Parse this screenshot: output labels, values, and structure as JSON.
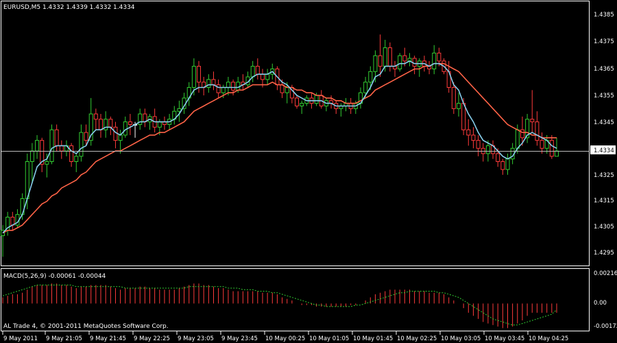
{
  "window": {
    "symbol_info": "EURUSD,M5  1.4332 1.4339 1.4332 1.4334",
    "macd_info": "MACD(5,26,9) -0.00061 -0.00044",
    "copyright": "AL Trade 4, © 2001-2011 MetaQuotes Software Corp.",
    "current_price_label": "1.4334"
  },
  "colors": {
    "background": "#000000",
    "grid_frame": "#ffffff",
    "bull_candle": "#32cd32",
    "bear_candle": "#ff3b3b",
    "doji_candle": "#ffffff",
    "fast_ma": "#87ceeb",
    "slow_ma": "#ff6347",
    "macd_hist": "#ff3b3b",
    "macd_signal": "#32cd32"
  },
  "price_axis": {
    "ticks": [
      "1.4385",
      "1.4375",
      "1.4365",
      "1.4355",
      "1.4345",
      "1.4334",
      "1.4325",
      "1.4315",
      "1.4305",
      "1.4295"
    ]
  },
  "macd_axis": {
    "ticks": [
      "0.00216",
      "0.00",
      "-0.00172"
    ]
  },
  "time_axis": {
    "labels": [
      "9 May 2011",
      "9 May 21:05",
      "9 May 21:45",
      "9 May 22:25",
      "9 May 23:05",
      "9 May 23:45",
      "10 May 00:25",
      "10 May 01:05",
      "10 May 01:45",
      "10 May 02:25",
      "10 May 03:05",
      "10 May 03:45",
      "10 May 04:25"
    ]
  },
  "chart_data": {
    "type": "candlestick",
    "symbol": "EURUSD",
    "timeframe": "M5",
    "price_range": [
      1.4291,
      1.439
    ],
    "current_price": 1.4334,
    "candles": [
      [
        1.4302,
        1.4306,
        1.4294,
        1.4304
      ],
      [
        1.4304,
        1.4311,
        1.4302,
        1.4309
      ],
      [
        1.4309,
        1.4311,
        1.4304,
        1.4306
      ],
      [
        1.4306,
        1.4312,
        1.4305,
        1.431
      ],
      [
        1.431,
        1.4318,
        1.4308,
        1.4316
      ],
      [
        1.4316,
        1.4333,
        1.4312,
        1.433
      ],
      [
        1.433,
        1.4337,
        1.4322,
        1.4334
      ],
      [
        1.4334,
        1.434,
        1.4331,
        1.4338
      ],
      [
        1.4338,
        1.4339,
        1.4326,
        1.4329
      ],
      [
        1.4329,
        1.4333,
        1.4324,
        1.433
      ],
      [
        1.433,
        1.4344,
        1.4329,
        1.4342
      ],
      [
        1.4342,
        1.4344,
        1.4334,
        1.4336
      ],
      [
        1.4336,
        1.4338,
        1.4331,
        1.4334
      ],
      [
        1.4334,
        1.4338,
        1.4332,
        1.4336
      ],
      [
        1.4336,
        1.4337,
        1.4328,
        1.433
      ],
      [
        1.433,
        1.4333,
        1.4326,
        1.4332
      ],
      [
        1.4332,
        1.4344,
        1.433,
        1.4341
      ],
      [
        1.4341,
        1.4344,
        1.4336,
        1.4338
      ],
      [
        1.4338,
        1.4354,
        1.4336,
        1.4348
      ],
      [
        1.4348,
        1.435,
        1.4342,
        1.4346
      ],
      [
        1.4346,
        1.4348,
        1.4339,
        1.4342
      ],
      [
        1.4342,
        1.4349,
        1.4339,
        1.4346
      ],
      [
        1.4346,
        1.4347,
        1.434,
        1.4343
      ],
      [
        1.4343,
        1.4345,
        1.4335,
        1.4338
      ],
      [
        1.4338,
        1.4342,
        1.4333,
        1.434
      ],
      [
        1.434,
        1.4347,
        1.4339,
        1.4345
      ],
      [
        1.4345,
        1.4348,
        1.434,
        1.4344
      ],
      [
        1.4344,
        1.4345,
        1.4339,
        1.4344
      ],
      [
        1.4344,
        1.435,
        1.4342,
        1.4348
      ],
      [
        1.4348,
        1.435,
        1.4343,
        1.4345
      ],
      [
        1.4345,
        1.4348,
        1.4342,
        1.4347
      ],
      [
        1.4347,
        1.435,
        1.4341,
        1.4343
      ],
      [
        1.4343,
        1.4346,
        1.434,
        1.4345
      ],
      [
        1.4345,
        1.4347,
        1.4342,
        1.4344
      ],
      [
        1.4344,
        1.4348,
        1.4342,
        1.4346
      ],
      [
        1.4346,
        1.4351,
        1.4344,
        1.4349
      ],
      [
        1.4349,
        1.4353,
        1.4345,
        1.435
      ],
      [
        1.435,
        1.4356,
        1.4348,
        1.4354
      ],
      [
        1.4354,
        1.436,
        1.4351,
        1.4358
      ],
      [
        1.4358,
        1.4369,
        1.4355,
        1.4366
      ],
      [
        1.4366,
        1.4368,
        1.4356,
        1.436
      ],
      [
        1.436,
        1.4362,
        1.4355,
        1.4358
      ],
      [
        1.4358,
        1.4363,
        1.4356,
        1.4361
      ],
      [
        1.4361,
        1.4364,
        1.4357,
        1.4359
      ],
      [
        1.4359,
        1.4361,
        1.4354,
        1.4356
      ],
      [
        1.4356,
        1.4359,
        1.4354,
        1.4358
      ],
      [
        1.4358,
        1.4362,
        1.4355,
        1.436
      ],
      [
        1.436,
        1.4361,
        1.4355,
        1.4357
      ],
      [
        1.4357,
        1.4362,
        1.4356,
        1.436
      ],
      [
        1.436,
        1.4363,
        1.4357,
        1.4359
      ],
      [
        1.4359,
        1.4364,
        1.4358,
        1.4362
      ],
      [
        1.4362,
        1.4368,
        1.436,
        1.4366
      ],
      [
        1.4366,
        1.4369,
        1.4361,
        1.4363
      ],
      [
        1.4363,
        1.4365,
        1.4358,
        1.4361
      ],
      [
        1.4361,
        1.4365,
        1.4359,
        1.4363
      ],
      [
        1.4363,
        1.4367,
        1.4361,
        1.4365
      ],
      [
        1.4365,
        1.4366,
        1.4357,
        1.4359
      ],
      [
        1.4359,
        1.4361,
        1.4354,
        1.4356
      ],
      [
        1.4356,
        1.436,
        1.4352,
        1.4358
      ],
      [
        1.4358,
        1.4359,
        1.4352,
        1.4354
      ],
      [
        1.4354,
        1.4355,
        1.435,
        1.4351
      ],
      [
        1.4351,
        1.4353,
        1.4348,
        1.4352
      ],
      [
        1.4352,
        1.4355,
        1.4351,
        1.4354
      ],
      [
        1.4354,
        1.4356,
        1.435,
        1.4352
      ],
      [
        1.4352,
        1.4356,
        1.4351,
        1.4355
      ],
      [
        1.4355,
        1.4357,
        1.435,
        1.4351
      ],
      [
        1.4351,
        1.4354,
        1.4349,
        1.4353
      ],
      [
        1.4353,
        1.4355,
        1.435,
        1.4352
      ],
      [
        1.4352,
        1.4353,
        1.4348,
        1.435
      ],
      [
        1.435,
        1.4352,
        1.4347,
        1.4351
      ],
      [
        1.4351,
        1.4354,
        1.4349,
        1.4352
      ],
      [
        1.4352,
        1.4354,
        1.4348,
        1.435
      ],
      [
        1.435,
        1.4353,
        1.4348,
        1.4352
      ],
      [
        1.4352,
        1.4358,
        1.435,
        1.4356
      ],
      [
        1.4356,
        1.4362,
        1.4354,
        1.436
      ],
      [
        1.436,
        1.4366,
        1.4357,
        1.4364
      ],
      [
        1.4364,
        1.4372,
        1.436,
        1.437
      ],
      [
        1.437,
        1.4378,
        1.4362,
        1.4366
      ],
      [
        1.4366,
        1.4376,
        1.4364,
        1.4373
      ],
      [
        1.4373,
        1.4375,
        1.4364,
        1.4366
      ],
      [
        1.4366,
        1.4368,
        1.4362,
        1.4365
      ],
      [
        1.4365,
        1.4371,
        1.4364,
        1.437
      ],
      [
        1.437,
        1.4373,
        1.4366,
        1.4368
      ],
      [
        1.4368,
        1.4371,
        1.4366,
        1.4369
      ],
      [
        1.4369,
        1.437,
        1.4363,
        1.4366
      ],
      [
        1.4366,
        1.4369,
        1.4362,
        1.4368
      ],
      [
        1.4368,
        1.437,
        1.4364,
        1.4366
      ],
      [
        1.4366,
        1.4368,
        1.4363,
        1.4365
      ],
      [
        1.4365,
        1.4374,
        1.4363,
        1.4371
      ],
      [
        1.4371,
        1.4373,
        1.4366,
        1.4368
      ],
      [
        1.4368,
        1.4369,
        1.4363,
        1.4364
      ],
      [
        1.4364,
        1.4368,
        1.4356,
        1.4358
      ],
      [
        1.4358,
        1.436,
        1.4348,
        1.435
      ],
      [
        1.435,
        1.4356,
        1.4347,
        1.4352
      ],
      [
        1.4352,
        1.4354,
        1.434,
        1.4342
      ],
      [
        1.4342,
        1.4346,
        1.4336,
        1.434
      ],
      [
        1.434,
        1.4343,
        1.4335,
        1.4338
      ],
      [
        1.4338,
        1.434,
        1.4332,
        1.4335
      ],
      [
        1.4335,
        1.4337,
        1.433,
        1.4333
      ],
      [
        1.4333,
        1.4338,
        1.433,
        1.4336
      ],
      [
        1.4336,
        1.4338,
        1.4331,
        1.4333
      ],
      [
        1.4333,
        1.4335,
        1.4328,
        1.433
      ],
      [
        1.433,
        1.4331,
        1.4325,
        1.4327
      ],
      [
        1.4327,
        1.4333,
        1.4325,
        1.4331
      ],
      [
        1.4331,
        1.4337,
        1.4329,
        1.4335
      ],
      [
        1.4335,
        1.4344,
        1.4333,
        1.4342
      ],
      [
        1.4342,
        1.4347,
        1.4336,
        1.4339
      ],
      [
        1.4339,
        1.4348,
        1.4337,
        1.4346
      ],
      [
        1.4346,
        1.4357,
        1.4341,
        1.4345
      ],
      [
        1.4345,
        1.4349,
        1.4336,
        1.4338
      ],
      [
        1.4338,
        1.4341,
        1.4333,
        1.4335
      ],
      [
        1.4335,
        1.434,
        1.4333,
        1.4338
      ],
      [
        1.4338,
        1.434,
        1.4331,
        1.4332
      ],
      [
        1.4332,
        1.4339,
        1.4332,
        1.4334
      ]
    ],
    "fast_ma": [
      1.4303,
      1.4305,
      1.4306,
      1.4307,
      1.431,
      1.4316,
      1.4322,
      1.4328,
      1.433,
      1.4331,
      1.4335,
      1.4336,
      1.4336,
      1.4336,
      1.4334,
      1.4333,
      1.4335,
      1.4336,
      1.434,
      1.4342,
      1.4342,
      1.4343,
      1.4343,
      1.4341,
      1.434,
      1.4342,
      1.4343,
      1.4344,
      1.4345,
      1.4345,
      1.4346,
      1.4345,
      1.4345,
      1.4345,
      1.4345,
      1.4346,
      1.4348,
      1.4351,
      1.4354,
      1.4357,
      1.4358,
      1.4358,
      1.4359,
      1.4359,
      1.4358,
      1.4358,
      1.4358,
      1.4358,
      1.4358,
      1.4359,
      1.436,
      1.4362,
      1.4363,
      1.4363,
      1.4363,
      1.4364,
      1.4362,
      1.436,
      1.4359,
      1.4357,
      1.4355,
      1.4354,
      1.4353,
      1.4353,
      1.4353,
      1.4353,
      1.4352,
      1.4352,
      1.4351,
      1.4351,
      1.4351,
      1.4351,
      1.4351,
      1.4352,
      1.4355,
      1.4358,
      1.4362,
      1.4363,
      1.4366,
      1.4366,
      1.4366,
      1.4367,
      1.4367,
      1.4368,
      1.4367,
      1.4367,
      1.4367,
      1.4366,
      1.4367,
      1.4367,
      1.4366,
      1.4364,
      1.4359,
      1.4357,
      1.4352,
      1.4348,
      1.4345,
      1.4341,
      1.4338,
      1.4337,
      1.4336,
      1.4334,
      1.4332,
      1.4331,
      1.4332,
      1.4335,
      1.4337,
      1.434,
      1.4341,
      1.434,
      1.4339,
      1.4338,
      1.4336,
      1.4335
    ],
    "slow_ma": [
      1.4303,
      1.4304,
      1.4304,
      1.4305,
      1.4306,
      1.4308,
      1.431,
      1.4312,
      1.4314,
      1.4315,
      1.4317,
      1.4318,
      1.432,
      1.4321,
      1.4322,
      1.4323,
      1.4325,
      1.4326,
      1.4328,
      1.433,
      1.4331,
      1.4332,
      1.4333,
      1.4334,
      1.4334,
      1.4335,
      1.4336,
      1.4337,
      1.4338,
      1.4339,
      1.434,
      1.434,
      1.4341,
      1.4341,
      1.4342,
      1.4343,
      1.4344,
      1.4345,
      1.4347,
      1.4349,
      1.435,
      1.4351,
      1.4352,
      1.4353,
      1.4354,
      1.4355,
      1.4356,
      1.4356,
      1.4357,
      1.4357,
      1.4358,
      1.4359,
      1.4359,
      1.4359,
      1.4359,
      1.436,
      1.4359,
      1.4359,
      1.4358,
      1.4358,
      1.4357,
      1.4357,
      1.4356,
      1.4356,
      1.4355,
      1.4355,
      1.4354,
      1.4354,
      1.4353,
      1.4353,
      1.4352,
      1.4352,
      1.4352,
      1.4353,
      1.4354,
      1.4355,
      1.4357,
      1.4358,
      1.4359,
      1.436,
      1.4361,
      1.4362,
      1.4363,
      1.4364,
      1.4365,
      1.4365,
      1.4366,
      1.4366,
      1.4367,
      1.4367,
      1.4367,
      1.4366,
      1.4365,
      1.4364,
      1.4362,
      1.436,
      1.4358,
      1.4356,
      1.4354,
      1.4352,
      1.435,
      1.4348,
      1.4346,
      1.4344,
      1.4343,
      1.4342,
      1.4341,
      1.4341,
      1.434,
      1.434,
      1.4339,
      1.4339,
      1.4339,
      1.4339
    ],
    "macd": {
      "range": [
        -0.00172,
        0.00216
      ],
      "hist": [
        0.0004,
        0.0005,
        0.0006,
        0.0006,
        0.0007,
        0.0009,
        0.0011,
        0.0012,
        0.0012,
        0.0012,
        0.0013,
        0.0013,
        0.0012,
        0.0012,
        0.0011,
        0.001,
        0.0011,
        0.0011,
        0.0012,
        0.0012,
        0.0012,
        0.0012,
        0.0011,
        0.001,
        0.0009,
        0.001,
        0.001,
        0.001,
        0.0011,
        0.0011,
        0.001,
        0.001,
        0.0009,
        0.0009,
        0.0009,
        0.0009,
        0.001,
        0.0011,
        0.0012,
        0.0013,
        0.0013,
        0.0012,
        0.0012,
        0.0011,
        0.001,
        0.001,
        0.0009,
        0.0008,
        0.0008,
        0.0008,
        0.0008,
        0.0008,
        0.0008,
        0.0007,
        0.0007,
        0.0007,
        0.0006,
        0.0004,
        0.0003,
        0.0002,
        0.0,
        -0.0001,
        -0.0001,
        -0.0001,
        -0.0002,
        -0.0002,
        -0.0002,
        -0.0002,
        -0.0002,
        -0.0002,
        -0.0002,
        -0.0001,
        -0.0001,
        0.0,
        0.0002,
        0.0004,
        0.0006,
        0.0007,
        0.0008,
        0.0009,
        0.0009,
        0.0009,
        0.0009,
        0.0009,
        0.0008,
        0.0008,
        0.0008,
        0.0007,
        0.0007,
        0.0007,
        0.0006,
        0.0004,
        0.0002,
        0.0,
        -0.0003,
        -0.0006,
        -0.0008,
        -0.001,
        -0.0012,
        -0.0013,
        -0.0014,
        -0.0015,
        -0.0016,
        -0.0016,
        -0.0015,
        -0.0013,
        -0.0011,
        -0.0008,
        -0.0006,
        -0.0006,
        -0.0006,
        -0.0006,
        -0.0006,
        -0.0006
      ],
      "signal": [
        0.0005,
        0.0006,
        0.0007,
        0.0008,
        0.0009,
        0.001,
        0.0011,
        0.0012,
        0.0012,
        0.0012,
        0.0012,
        0.0012,
        0.0012,
        0.0012,
        0.0012,
        0.0011,
        0.0011,
        0.0011,
        0.0011,
        0.0011,
        0.0011,
        0.0011,
        0.0011,
        0.0011,
        0.0011,
        0.001,
        0.001,
        0.001,
        0.001,
        0.001,
        0.001,
        0.001,
        0.001,
        0.001,
        0.001,
        0.001,
        0.001,
        0.001,
        0.0011,
        0.0011,
        0.0011,
        0.0011,
        0.0011,
        0.0011,
        0.0011,
        0.0011,
        0.001,
        0.001,
        0.001,
        0.0009,
        0.0009,
        0.0009,
        0.0008,
        0.0008,
        0.0008,
        0.0007,
        0.0007,
        0.0006,
        0.0005,
        0.0004,
        0.0003,
        0.0002,
        0.0001,
        0.0,
        -0.0001,
        -0.0001,
        -0.0002,
        -0.0002,
        -0.0002,
        -0.0002,
        -0.0002,
        -0.0002,
        -0.0001,
        -0.0001,
        0.0,
        0.0001,
        0.0002,
        0.0003,
        0.0004,
        0.0005,
        0.0006,
        0.0007,
        0.0007,
        0.0008,
        0.0008,
        0.0008,
        0.0008,
        0.0008,
        0.0008,
        0.0007,
        0.0007,
        0.0006,
        0.0005,
        0.0004,
        0.0002,
        0.0,
        -0.0002,
        -0.0004,
        -0.0006,
        -0.0008,
        -0.001,
        -0.0011,
        -0.0012,
        -0.0013,
        -0.0014,
        -0.0014,
        -0.0013,
        -0.0012,
        -0.0011,
        -0.001,
        -0.0009,
        -0.0008,
        -0.0007,
        -0.0004
      ]
    }
  }
}
